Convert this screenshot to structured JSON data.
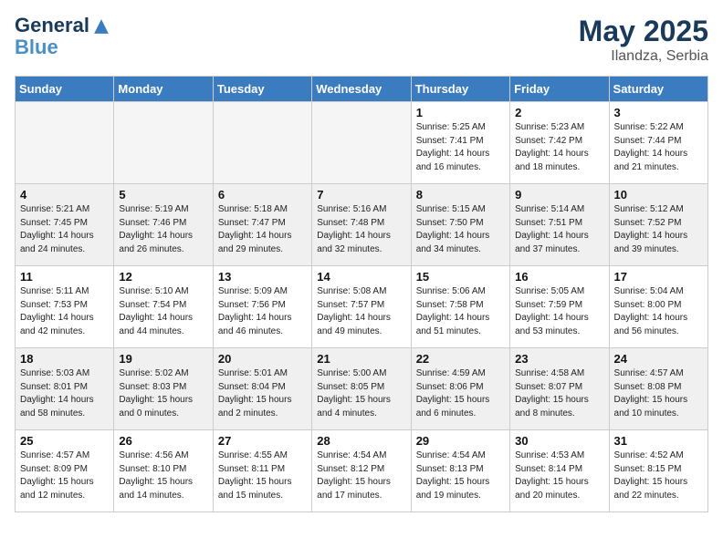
{
  "header": {
    "logo_line1": "General",
    "logo_line2": "Blue",
    "month": "May 2025",
    "location": "Ilandza, Serbia"
  },
  "weekdays": [
    "Sunday",
    "Monday",
    "Tuesday",
    "Wednesday",
    "Thursday",
    "Friday",
    "Saturday"
  ],
  "weeks": [
    [
      {
        "num": "",
        "detail": "",
        "empty": true
      },
      {
        "num": "",
        "detail": "",
        "empty": true
      },
      {
        "num": "",
        "detail": "",
        "empty": true
      },
      {
        "num": "",
        "detail": "",
        "empty": true
      },
      {
        "num": "1",
        "detail": "Sunrise: 5:25 AM\nSunset: 7:41 PM\nDaylight: 14 hours\nand 16 minutes."
      },
      {
        "num": "2",
        "detail": "Sunrise: 5:23 AM\nSunset: 7:42 PM\nDaylight: 14 hours\nand 18 minutes."
      },
      {
        "num": "3",
        "detail": "Sunrise: 5:22 AM\nSunset: 7:44 PM\nDaylight: 14 hours\nand 21 minutes."
      }
    ],
    [
      {
        "num": "4",
        "detail": "Sunrise: 5:21 AM\nSunset: 7:45 PM\nDaylight: 14 hours\nand 24 minutes.",
        "shaded": true
      },
      {
        "num": "5",
        "detail": "Sunrise: 5:19 AM\nSunset: 7:46 PM\nDaylight: 14 hours\nand 26 minutes.",
        "shaded": true
      },
      {
        "num": "6",
        "detail": "Sunrise: 5:18 AM\nSunset: 7:47 PM\nDaylight: 14 hours\nand 29 minutes.",
        "shaded": true
      },
      {
        "num": "7",
        "detail": "Sunrise: 5:16 AM\nSunset: 7:48 PM\nDaylight: 14 hours\nand 32 minutes.",
        "shaded": true
      },
      {
        "num": "8",
        "detail": "Sunrise: 5:15 AM\nSunset: 7:50 PM\nDaylight: 14 hours\nand 34 minutes.",
        "shaded": true
      },
      {
        "num": "9",
        "detail": "Sunrise: 5:14 AM\nSunset: 7:51 PM\nDaylight: 14 hours\nand 37 minutes.",
        "shaded": true
      },
      {
        "num": "10",
        "detail": "Sunrise: 5:12 AM\nSunset: 7:52 PM\nDaylight: 14 hours\nand 39 minutes.",
        "shaded": true
      }
    ],
    [
      {
        "num": "11",
        "detail": "Sunrise: 5:11 AM\nSunset: 7:53 PM\nDaylight: 14 hours\nand 42 minutes."
      },
      {
        "num": "12",
        "detail": "Sunrise: 5:10 AM\nSunset: 7:54 PM\nDaylight: 14 hours\nand 44 minutes."
      },
      {
        "num": "13",
        "detail": "Sunrise: 5:09 AM\nSunset: 7:56 PM\nDaylight: 14 hours\nand 46 minutes."
      },
      {
        "num": "14",
        "detail": "Sunrise: 5:08 AM\nSunset: 7:57 PM\nDaylight: 14 hours\nand 49 minutes."
      },
      {
        "num": "15",
        "detail": "Sunrise: 5:06 AM\nSunset: 7:58 PM\nDaylight: 14 hours\nand 51 minutes."
      },
      {
        "num": "16",
        "detail": "Sunrise: 5:05 AM\nSunset: 7:59 PM\nDaylight: 14 hours\nand 53 minutes."
      },
      {
        "num": "17",
        "detail": "Sunrise: 5:04 AM\nSunset: 8:00 PM\nDaylight: 14 hours\nand 56 minutes."
      }
    ],
    [
      {
        "num": "18",
        "detail": "Sunrise: 5:03 AM\nSunset: 8:01 PM\nDaylight: 14 hours\nand 58 minutes.",
        "shaded": true
      },
      {
        "num": "19",
        "detail": "Sunrise: 5:02 AM\nSunset: 8:03 PM\nDaylight: 15 hours\nand 0 minutes.",
        "shaded": true
      },
      {
        "num": "20",
        "detail": "Sunrise: 5:01 AM\nSunset: 8:04 PM\nDaylight: 15 hours\nand 2 minutes.",
        "shaded": true
      },
      {
        "num": "21",
        "detail": "Sunrise: 5:00 AM\nSunset: 8:05 PM\nDaylight: 15 hours\nand 4 minutes.",
        "shaded": true
      },
      {
        "num": "22",
        "detail": "Sunrise: 4:59 AM\nSunset: 8:06 PM\nDaylight: 15 hours\nand 6 minutes.",
        "shaded": true
      },
      {
        "num": "23",
        "detail": "Sunrise: 4:58 AM\nSunset: 8:07 PM\nDaylight: 15 hours\nand 8 minutes.",
        "shaded": true
      },
      {
        "num": "24",
        "detail": "Sunrise: 4:57 AM\nSunset: 8:08 PM\nDaylight: 15 hours\nand 10 minutes.",
        "shaded": true
      }
    ],
    [
      {
        "num": "25",
        "detail": "Sunrise: 4:57 AM\nSunset: 8:09 PM\nDaylight: 15 hours\nand 12 minutes."
      },
      {
        "num": "26",
        "detail": "Sunrise: 4:56 AM\nSunset: 8:10 PM\nDaylight: 15 hours\nand 14 minutes."
      },
      {
        "num": "27",
        "detail": "Sunrise: 4:55 AM\nSunset: 8:11 PM\nDaylight: 15 hours\nand 15 minutes."
      },
      {
        "num": "28",
        "detail": "Sunrise: 4:54 AM\nSunset: 8:12 PM\nDaylight: 15 hours\nand 17 minutes."
      },
      {
        "num": "29",
        "detail": "Sunrise: 4:54 AM\nSunset: 8:13 PM\nDaylight: 15 hours\nand 19 minutes."
      },
      {
        "num": "30",
        "detail": "Sunrise: 4:53 AM\nSunset: 8:14 PM\nDaylight: 15 hours\nand 20 minutes."
      },
      {
        "num": "31",
        "detail": "Sunrise: 4:52 AM\nSunset: 8:15 PM\nDaylight: 15 hours\nand 22 minutes."
      }
    ]
  ]
}
